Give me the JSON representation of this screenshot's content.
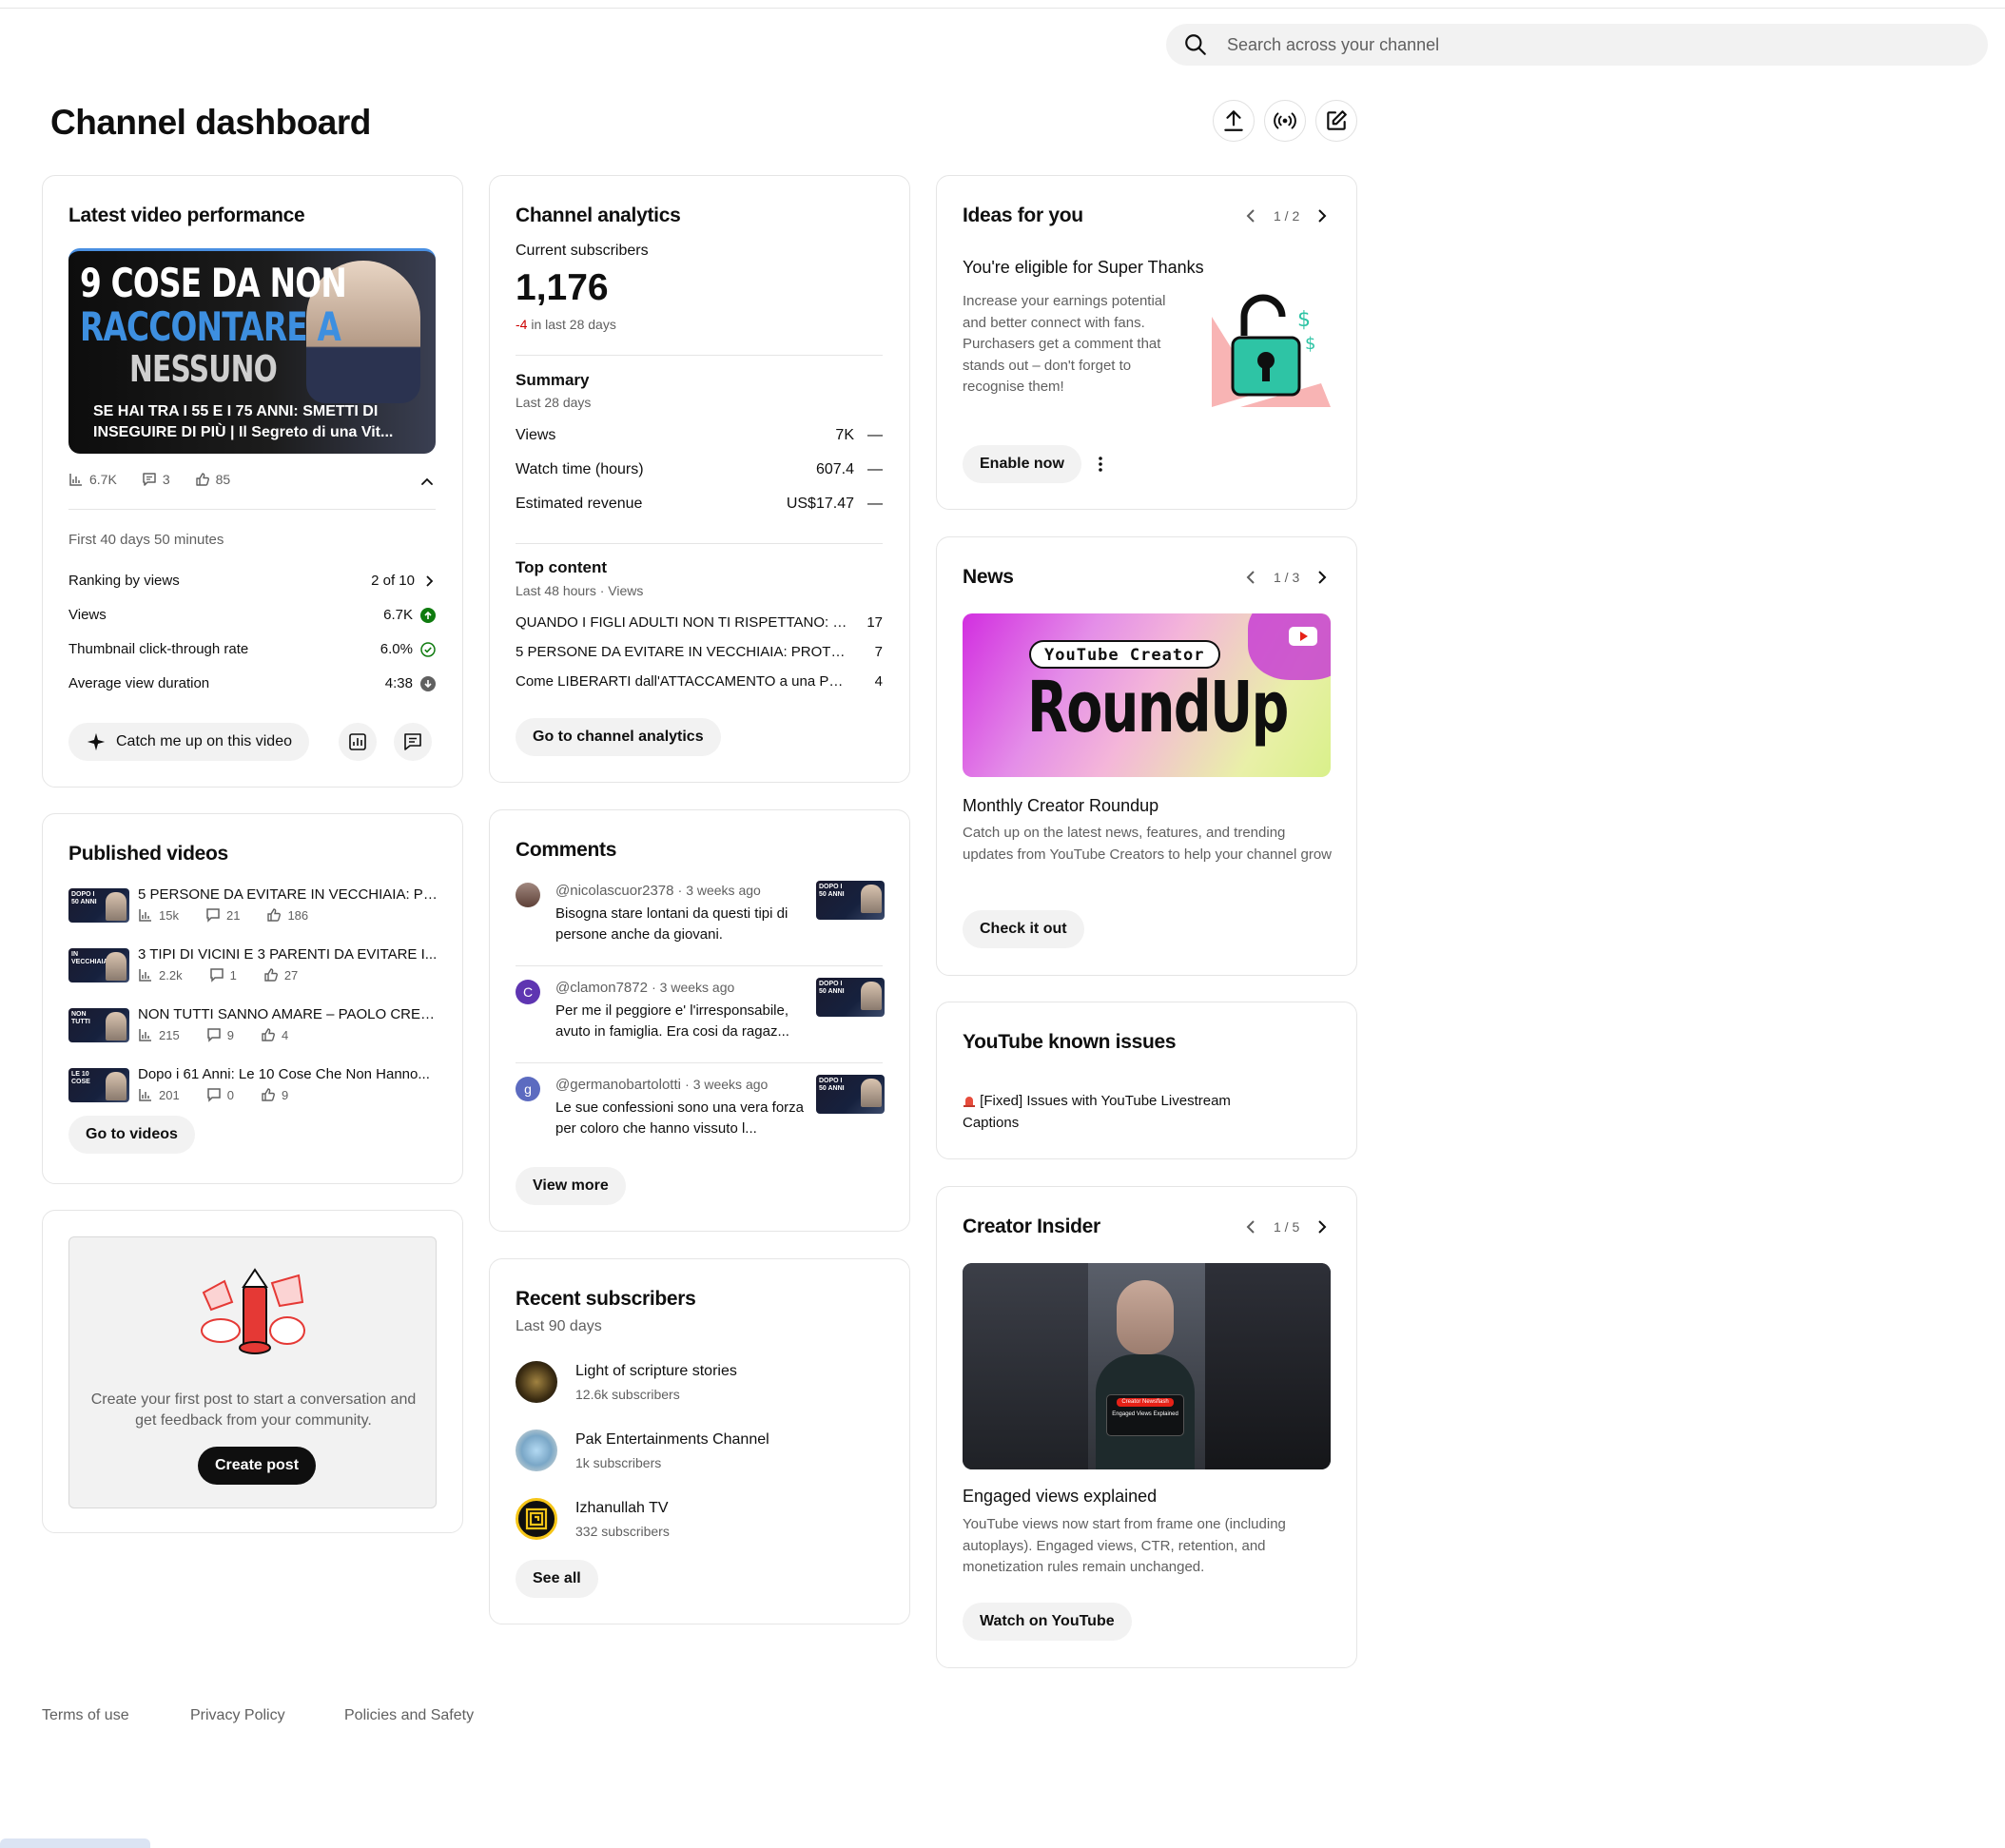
{
  "search": {
    "placeholder": "Search across your channel"
  },
  "page_title": "Channel dashboard",
  "latest_video": {
    "title": "Latest video performance",
    "thumb_line1": "9 COSE DA NON",
    "thumb_line2": "RACCONTARE A",
    "thumb_line3": "NESSUNO",
    "video_title": "SE HAI TRA I 55 E I 75 ANNI: SMETTI DI INSEGUIRE DI PIÙ | Il Segreto di una Vit...",
    "views": "6.7K",
    "comments": "3",
    "likes": "85",
    "period": "First 40 days 50 minutes",
    "metrics": [
      {
        "label": "Ranking by views",
        "value": "2 of 10"
      },
      {
        "label": "Views",
        "value": "6.7K"
      },
      {
        "label": "Thumbnail click-through rate",
        "value": "6.0%"
      },
      {
        "label": "Average view duration",
        "value": "4:38"
      }
    ],
    "catch_up_label": "Catch me up on this video"
  },
  "analytics": {
    "title": "Channel analytics",
    "subs_label": "Current subscribers",
    "subs_value": "1,176",
    "subs_change": "-4",
    "subs_change_suffix": "in last 28 days",
    "summary_title": "Summary",
    "summary_period": "Last 28 days",
    "summary_rows": [
      {
        "label": "Views",
        "value": "7K",
        "trend": "—"
      },
      {
        "label": "Watch time (hours)",
        "value": "607.4",
        "trend": "—"
      },
      {
        "label": "Estimated revenue",
        "value": "US$17.47",
        "trend": "—"
      }
    ],
    "top_title": "Top content",
    "top_period": "Last 48 hours · Views",
    "top_rows": [
      {
        "title": "QUANDO I FIGLI ADULTI NON TI RISPETTANO: 6 ...",
        "value": "17"
      },
      {
        "title": "5 PERSONE DA EVITARE IN VECCHIAIA: PROTEG...",
        "value": "7"
      },
      {
        "title": "Come LIBERARTI dall'ATTACCAMENTO a una PER...",
        "value": "4"
      }
    ],
    "button": "Go to channel analytics"
  },
  "ideas": {
    "title": "Ideas for you",
    "pager": "1 / 2",
    "heading": "You're eligible for Super Thanks",
    "body": "Increase your earnings potential and better connect with fans. Purchasers get a comment that stands out – don't forget to recognise them!",
    "button": "Enable now"
  },
  "news": {
    "title": "News",
    "pager": "1 / 3",
    "banner_tag": "YouTube Creator",
    "banner_title": "RoundUp",
    "heading": "Monthly Creator Roundup",
    "body": "Catch up on the latest news, features, and trending updates from YouTube Creators to help your channel grow",
    "button": "Check it out"
  },
  "known_issues": {
    "title": "YouTube known issues",
    "item": "[Fixed] Issues with YouTube Livestream Captions"
  },
  "insider": {
    "title": "Creator Insider",
    "pager": "1 / 5",
    "video_tag": "Creator Newsflash",
    "video_caption": "Engaged Views Explained",
    "heading": "Engaged views explained",
    "body": "YouTube views now start from frame one (including autoplays). Engaged views, CTR, retention, and monetization rules remain unchanged.",
    "button": "Watch on YouTube"
  },
  "published": {
    "title": "Published videos",
    "videos": [
      {
        "title": "5 PERSONE DA EVITARE IN VECCHIAIA: PR...",
        "views": "15k",
        "comments": "21",
        "likes": "186",
        "thumb": "DOPO I 50 ANNI"
      },
      {
        "title": "3 TIPI DI VICINI E 3 PARENTI DA EVITARE I...",
        "views": "2.2k",
        "comments": "1",
        "likes": "27",
        "thumb": "IN VECCHIAIA"
      },
      {
        "title": "NON TUTTI SANNO AMARE – PAOLO CREP...",
        "views": "215",
        "comments": "9",
        "likes": "4",
        "thumb": "NON TUTTI"
      },
      {
        "title": "Dopo i 61 Anni: Le 10 Cose Che Non Hanno...",
        "views": "201",
        "comments": "0",
        "likes": "9",
        "thumb": "LE 10 COSE"
      }
    ],
    "button": "Go to videos"
  },
  "comments": {
    "title": "Comments",
    "items": [
      {
        "user": "@nicolascuor2378",
        "time": "· 3 weeks ago",
        "text": "Bisogna stare lontani da questi tipi di persone anche da giovani.",
        "avatar": "",
        "avatar_color": "#8d6e63"
      },
      {
        "user": "@clamon7872",
        "time": "· 3 weeks ago",
        "text": "Per me il peggiore e' l'irresponsabile, avuto in famiglia. Era cosi da ragaz...",
        "avatar": "C",
        "avatar_color": "#5e35b1"
      },
      {
        "user": "@germanobartolotti",
        "time": "· 3 weeks ago",
        "text": "Le sue confessioni sono una vera forza per coloro che hanno vissuto l...",
        "avatar": "g",
        "avatar_color": "#5c6bc0"
      }
    ],
    "button": "View more"
  },
  "post": {
    "text": "Create your first post to start a conversation and get feedback from your community.",
    "button": "Create post"
  },
  "subscribers": {
    "title": "Recent subscribers",
    "period": "Last 90 days",
    "items": [
      {
        "name": "Light of scripture stories",
        "count": "12.6k subscribers"
      },
      {
        "name": "Pak Entertainments Channel",
        "count": "1k subscribers"
      },
      {
        "name": "Izhanullah TV",
        "count": "332 subscribers"
      }
    ],
    "button": "See all"
  },
  "footer": {
    "terms": "Terms of use",
    "privacy": "Privacy Policy",
    "policies": "Policies and Safety"
  },
  "colors": {
    "accent_green": "#0f7b0f",
    "negative_red": "#cc0000",
    "pill_bg": "#f2f2f2"
  }
}
